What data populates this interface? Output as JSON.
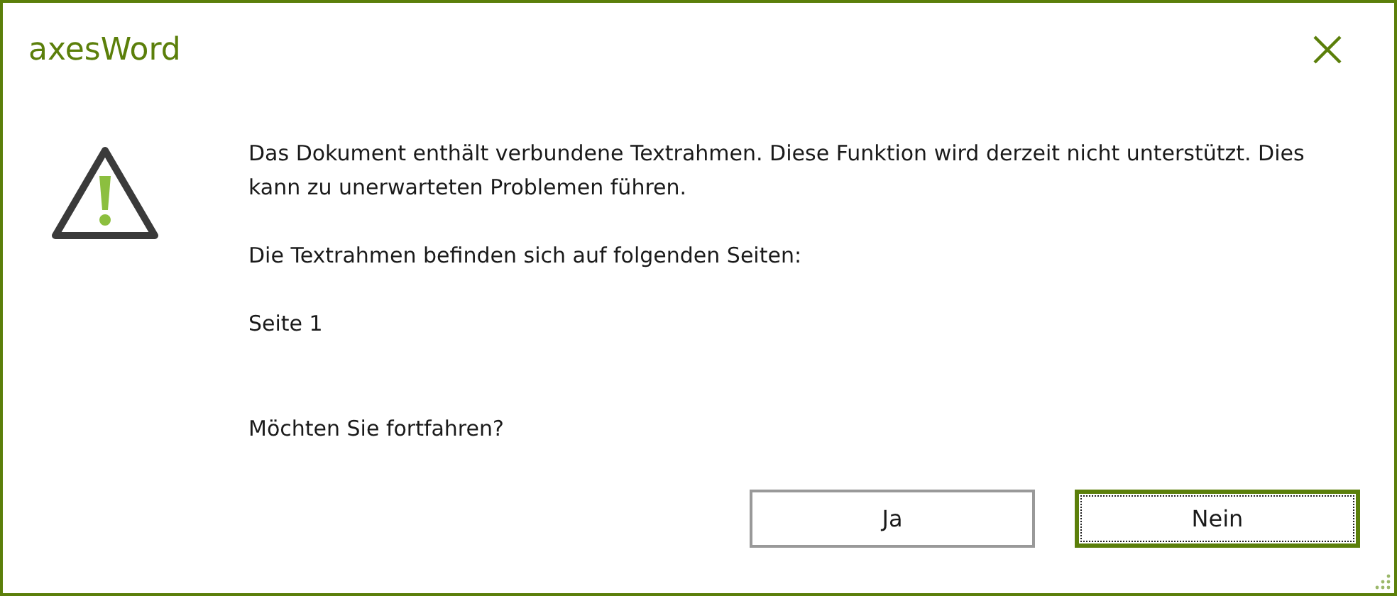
{
  "window": {
    "title": "axesWord"
  },
  "message": {
    "paragraphs": [
      "Das Dokument enthält verbundene Textrahmen. Diese Funktion wird derzeit nicht unterstützt. Dies kann zu unerwarteten Problemen führen.",
      "Die Textrahmen befinden sich auf folgenden Seiten:",
      "Seite 1"
    ],
    "question": "Möchten Sie fortfahren?"
  },
  "buttons": [
    {
      "label": "Ja",
      "focused": false
    },
    {
      "label": "Nein",
      "focused": true
    }
  ]
}
